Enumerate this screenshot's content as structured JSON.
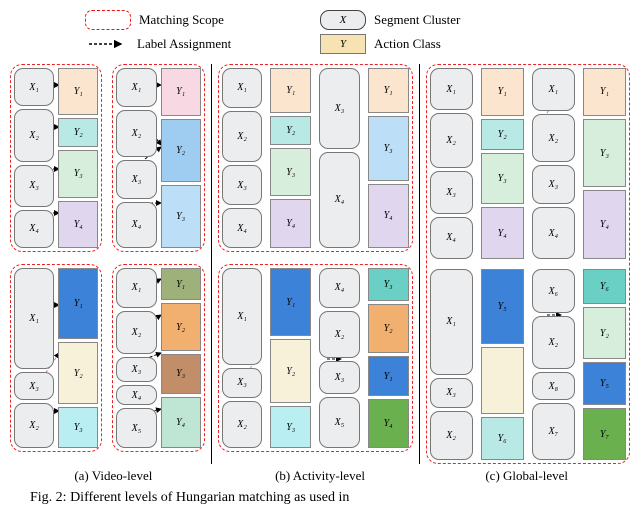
{
  "legend": {
    "scope": "Matching Scope",
    "cluster": "Segment Cluster",
    "assign": "Label Assignment",
    "class": "Action Class",
    "x": "X",
    "y": "Y"
  },
  "x": {
    "1": "X₁",
    "2": "X₂",
    "3": "X₃",
    "4": "X₄",
    "5": "X₅",
    "6": "X₆",
    "7": "X₇",
    "8": "X₈"
  },
  "y": {
    "1": "Y₁",
    "2": "Y₂",
    "3": "Y₃",
    "4": "Y₄",
    "5": "Y₅",
    "6": "Y₆",
    "7": "Y₇"
  },
  "cap": {
    "a": "(a) Video-level",
    "b": "(b) Activity-level",
    "c": "(c) Global-level"
  },
  "caption": "Fig. 2: Different levels of Hungarian matching as used in"
}
